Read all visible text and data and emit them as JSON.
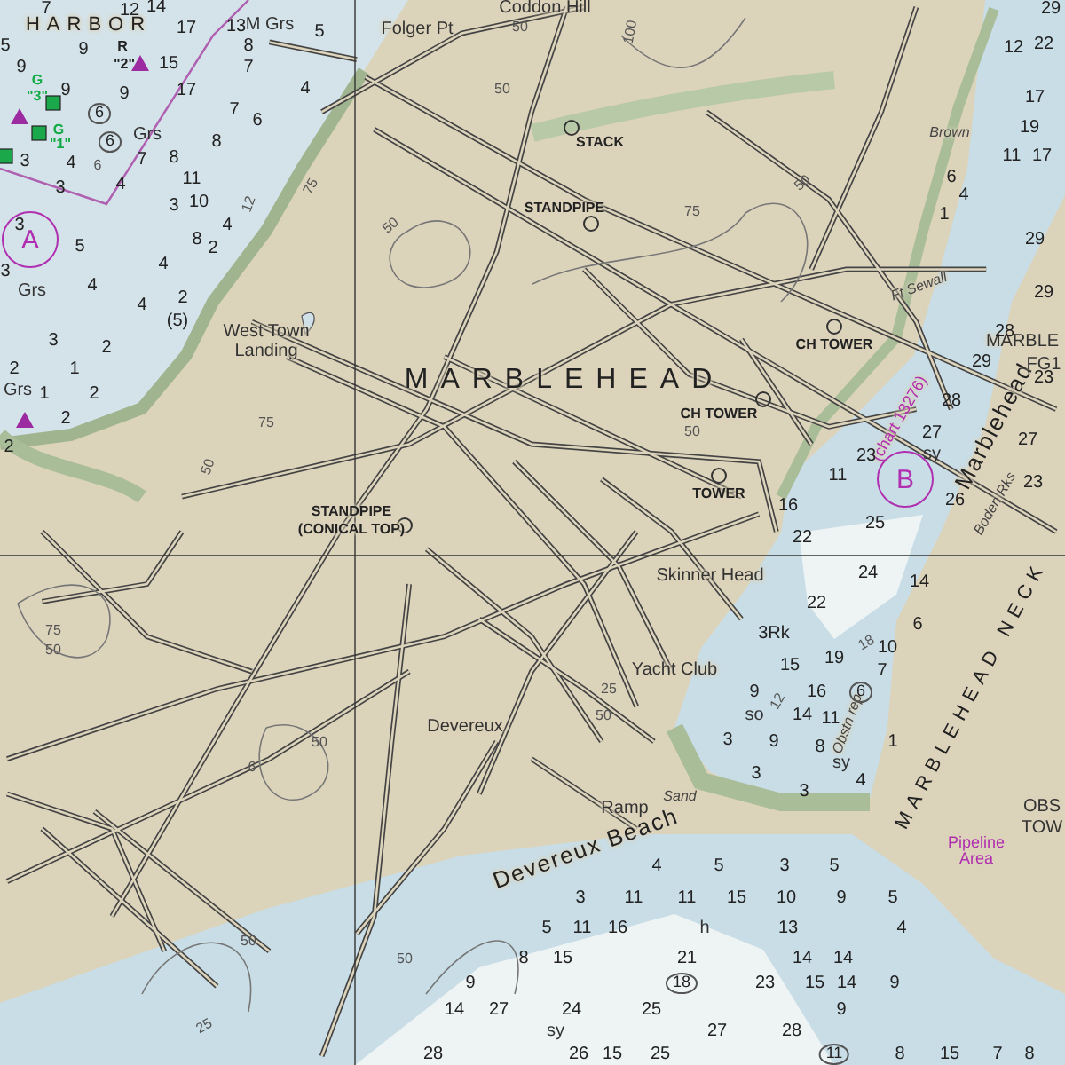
{
  "chart": {
    "place_names": [
      {
        "text": "HARBOR",
        "kind": "district"
      },
      {
        "text": "Coddon Hill",
        "kind": "locality"
      },
      {
        "text": "Folger Pt",
        "kind": "locality"
      },
      {
        "text": "West Town Landing",
        "kind": "locality"
      },
      {
        "text": "MARBLEHEAD",
        "kind": "town"
      },
      {
        "text": "Ft Sewall",
        "kind": "minor"
      },
      {
        "text": "Brown",
        "kind": "minor"
      },
      {
        "text": "(chart 13276)",
        "kind": "note"
      },
      {
        "text": "Marblehead",
        "kind": "water"
      },
      {
        "text": "Boden Rks",
        "kind": "minor"
      },
      {
        "text": "MARBLE",
        "kind": "locality"
      },
      {
        "text": "FG1",
        "kind": "locality"
      },
      {
        "text": "Skinner Head",
        "kind": "locality"
      },
      {
        "text": "Yacht Club",
        "kind": "locality"
      },
      {
        "text": "Devereux",
        "kind": "locality"
      },
      {
        "text": "Sand",
        "kind": "minor"
      },
      {
        "text": "Ramp",
        "kind": "locality"
      },
      {
        "text": "Devereux Beach",
        "kind": "water"
      },
      {
        "text": "Obstn rep",
        "kind": "minor"
      },
      {
        "text": "MARBLEHEAD NECK",
        "kind": "district"
      },
      {
        "text": "Pipeline Area",
        "kind": "note"
      },
      {
        "text": "OBS",
        "kind": "locality"
      },
      {
        "text": "TOW",
        "kind": "locality"
      }
    ],
    "landmarks": [
      {
        "text": "STACK"
      },
      {
        "text": "STANDPIPE"
      },
      {
        "text": "CH TOWER"
      },
      {
        "text": "CH TOWER"
      },
      {
        "text": "TOWER"
      },
      {
        "text": "STANDPIPE"
      },
      {
        "text": "(CONICAL TOP)"
      }
    ],
    "buoys": [
      {
        "text": "R",
        "kind": "red"
      },
      {
        "text": "\"2\"",
        "kind": "red"
      },
      {
        "text": "G",
        "kind": "green"
      },
      {
        "text": "\"3\"",
        "kind": "green"
      },
      {
        "text": "G",
        "kind": "green"
      },
      {
        "text": "\"1\"",
        "kind": "green"
      }
    ],
    "anchorages": [
      {
        "text": "A"
      },
      {
        "text": "B"
      }
    ],
    "soundings": [
      {
        "text": "7",
        "kind": "depth"
      },
      {
        "text": "12",
        "kind": "depth"
      },
      {
        "text": "14",
        "kind": "depth"
      },
      {
        "text": "17",
        "kind": "depth"
      },
      {
        "text": "13",
        "kind": "depth"
      },
      {
        "text": "M Grs",
        "kind": "bottom"
      },
      {
        "text": "5",
        "kind": "depth"
      },
      {
        "text": "5",
        "kind": "depth"
      },
      {
        "text": "9",
        "kind": "depth"
      },
      {
        "text": "8",
        "kind": "depth"
      },
      {
        "text": "9",
        "kind": "depth"
      },
      {
        "text": "15",
        "kind": "depth"
      },
      {
        "text": "7",
        "kind": "depth"
      },
      {
        "text": "9",
        "kind": "depth"
      },
      {
        "text": "9",
        "kind": "depth"
      },
      {
        "text": "17",
        "kind": "depth"
      },
      {
        "text": "4",
        "kind": "depth"
      },
      {
        "text": "6",
        "kind": "circled"
      },
      {
        "text": "7",
        "kind": "depth"
      },
      {
        "text": "6",
        "kind": "depth"
      },
      {
        "text": "6",
        "kind": "circled"
      },
      {
        "text": "Grs",
        "kind": "bottom"
      },
      {
        "text": "8",
        "kind": "depth"
      },
      {
        "text": "3",
        "kind": "depth"
      },
      {
        "text": "4",
        "kind": "depth"
      },
      {
        "text": "7",
        "kind": "depth"
      },
      {
        "text": "8",
        "kind": "depth"
      },
      {
        "text": "3",
        "kind": "depth"
      },
      {
        "text": "4",
        "kind": "depth"
      },
      {
        "text": "11",
        "kind": "depth"
      },
      {
        "text": "3",
        "kind": "depth"
      },
      {
        "text": "10",
        "kind": "depth"
      },
      {
        "text": "3",
        "kind": "depth"
      },
      {
        "text": "4",
        "kind": "depth"
      },
      {
        "text": "5",
        "kind": "depth"
      },
      {
        "text": "8",
        "kind": "depth"
      },
      {
        "text": "2",
        "kind": "depth"
      },
      {
        "text": "3",
        "kind": "depth"
      },
      {
        "text": "4",
        "kind": "depth"
      },
      {
        "text": "Grs",
        "kind": "bottom"
      },
      {
        "text": "4",
        "kind": "depth"
      },
      {
        "text": "4",
        "kind": "depth"
      },
      {
        "text": "2",
        "kind": "depth"
      },
      {
        "text": "(5)",
        "kind": "depth"
      },
      {
        "text": "3",
        "kind": "depth"
      },
      {
        "text": "2",
        "kind": "depth"
      },
      {
        "text": "2",
        "kind": "depth"
      },
      {
        "text": "1",
        "kind": "depth"
      },
      {
        "text": "Grs",
        "kind": "bottom"
      },
      {
        "text": "1",
        "kind": "depth"
      },
      {
        "text": "2",
        "kind": "depth"
      },
      {
        "text": "2",
        "kind": "depth"
      },
      {
        "text": "2",
        "kind": "depth"
      },
      {
        "text": "29",
        "kind": "depth"
      },
      {
        "text": "12",
        "kind": "depth"
      },
      {
        "text": "22",
        "kind": "depth"
      },
      {
        "text": "17",
        "kind": "depth"
      },
      {
        "text": "19",
        "kind": "depth"
      },
      {
        "text": "11",
        "kind": "depth"
      },
      {
        "text": "17",
        "kind": "depth"
      },
      {
        "text": "6",
        "kind": "depth"
      },
      {
        "text": "4",
        "kind": "depth"
      },
      {
        "text": "1",
        "kind": "depth"
      },
      {
        "text": "29",
        "kind": "depth"
      },
      {
        "text": "29",
        "kind": "depth"
      },
      {
        "text": "28",
        "kind": "depth"
      },
      {
        "text": "29",
        "kind": "depth"
      },
      {
        "text": "23",
        "kind": "depth"
      },
      {
        "text": "28",
        "kind": "depth"
      },
      {
        "text": "27",
        "kind": "depth"
      },
      {
        "text": "23",
        "kind": "depth"
      },
      {
        "text": "sy",
        "kind": "bottom"
      },
      {
        "text": "27",
        "kind": "depth"
      },
      {
        "text": "11",
        "kind": "depth"
      },
      {
        "text": "23",
        "kind": "depth"
      },
      {
        "text": "16",
        "kind": "depth"
      },
      {
        "text": "26",
        "kind": "depth"
      },
      {
        "text": "25",
        "kind": "depth"
      },
      {
        "text": "22",
        "kind": "depth"
      },
      {
        "text": "24",
        "kind": "depth"
      },
      {
        "text": "14",
        "kind": "depth"
      },
      {
        "text": "22",
        "kind": "depth"
      },
      {
        "text": "3Rk",
        "kind": "depth"
      },
      {
        "text": "6",
        "kind": "depth"
      },
      {
        "text": "10",
        "kind": "depth"
      },
      {
        "text": "15",
        "kind": "depth"
      },
      {
        "text": "19",
        "kind": "depth"
      },
      {
        "text": "7",
        "kind": "depth"
      },
      {
        "text": "9",
        "kind": "depth"
      },
      {
        "text": "16",
        "kind": "depth"
      },
      {
        "text": "6",
        "kind": "circled"
      },
      {
        "text": "so",
        "kind": "bottom"
      },
      {
        "text": "14",
        "kind": "depth"
      },
      {
        "text": "11",
        "kind": "depth"
      },
      {
        "text": "3",
        "kind": "depth"
      },
      {
        "text": "9",
        "kind": "depth"
      },
      {
        "text": "8",
        "kind": "depth"
      },
      {
        "text": "sy",
        "kind": "bottom"
      },
      {
        "text": "1",
        "kind": "depth"
      },
      {
        "text": "3",
        "kind": "depth"
      },
      {
        "text": "3",
        "kind": "depth"
      },
      {
        "text": "4",
        "kind": "depth"
      },
      {
        "text": "4",
        "kind": "depth"
      },
      {
        "text": "5",
        "kind": "depth"
      },
      {
        "text": "3",
        "kind": "depth"
      },
      {
        "text": "5",
        "kind": "depth"
      },
      {
        "text": "3",
        "kind": "depth"
      },
      {
        "text": "11",
        "kind": "depth"
      },
      {
        "text": "11",
        "kind": "depth"
      },
      {
        "text": "15",
        "kind": "depth"
      },
      {
        "text": "10",
        "kind": "depth"
      },
      {
        "text": "9",
        "kind": "depth"
      },
      {
        "text": "5",
        "kind": "depth"
      },
      {
        "text": "5",
        "kind": "depth"
      },
      {
        "text": "11",
        "kind": "depth"
      },
      {
        "text": "16",
        "kind": "depth"
      },
      {
        "text": "h",
        "kind": "bottom"
      },
      {
        "text": "13",
        "kind": "depth"
      },
      {
        "text": "4",
        "kind": "depth"
      },
      {
        "text": "8",
        "kind": "depth"
      },
      {
        "text": "15",
        "kind": "depth"
      },
      {
        "text": "21",
        "kind": "depth"
      },
      {
        "text": "14",
        "kind": "depth"
      },
      {
        "text": "14",
        "kind": "depth"
      },
      {
        "text": "9",
        "kind": "depth"
      },
      {
        "text": "18",
        "kind": "circled"
      },
      {
        "text": "23",
        "kind": "depth"
      },
      {
        "text": "15",
        "kind": "depth"
      },
      {
        "text": "14",
        "kind": "depth"
      },
      {
        "text": "9",
        "kind": "depth"
      },
      {
        "text": "14",
        "kind": "depth"
      },
      {
        "text": "27",
        "kind": "depth"
      },
      {
        "text": "24",
        "kind": "depth"
      },
      {
        "text": "25",
        "kind": "depth"
      },
      {
        "text": "9",
        "kind": "depth"
      },
      {
        "text": "sy",
        "kind": "bottom"
      },
      {
        "text": "27",
        "kind": "depth"
      },
      {
        "text": "28",
        "kind": "depth"
      },
      {
        "text": "28",
        "kind": "depth"
      },
      {
        "text": "26",
        "kind": "depth"
      },
      {
        "text": "15",
        "kind": "depth"
      },
      {
        "text": "25",
        "kind": "depth"
      },
      {
        "text": "11",
        "kind": "circled"
      },
      {
        "text": "8",
        "kind": "depth"
      },
      {
        "text": "15",
        "kind": "depth"
      },
      {
        "text": "7",
        "kind": "depth"
      },
      {
        "text": "8",
        "kind": "depth"
      }
    ],
    "contours": [
      {
        "text": "50"
      },
      {
        "text": "100"
      },
      {
        "text": "50"
      },
      {
        "text": "75"
      },
      {
        "text": "50"
      },
      {
        "text": "75"
      },
      {
        "text": "50"
      },
      {
        "text": "75"
      },
      {
        "text": "50"
      },
      {
        "text": "50"
      },
      {
        "text": "75"
      },
      {
        "text": "50"
      },
      {
        "text": "50"
      },
      {
        "text": "50"
      },
      {
        "text": "25"
      },
      {
        "text": "50"
      },
      {
        "text": "25"
      },
      {
        "text": "50"
      },
      {
        "text": "12"
      },
      {
        "text": "6"
      },
      {
        "text": "12"
      },
      {
        "text": "18"
      },
      {
        "text": "6"
      }
    ]
  }
}
